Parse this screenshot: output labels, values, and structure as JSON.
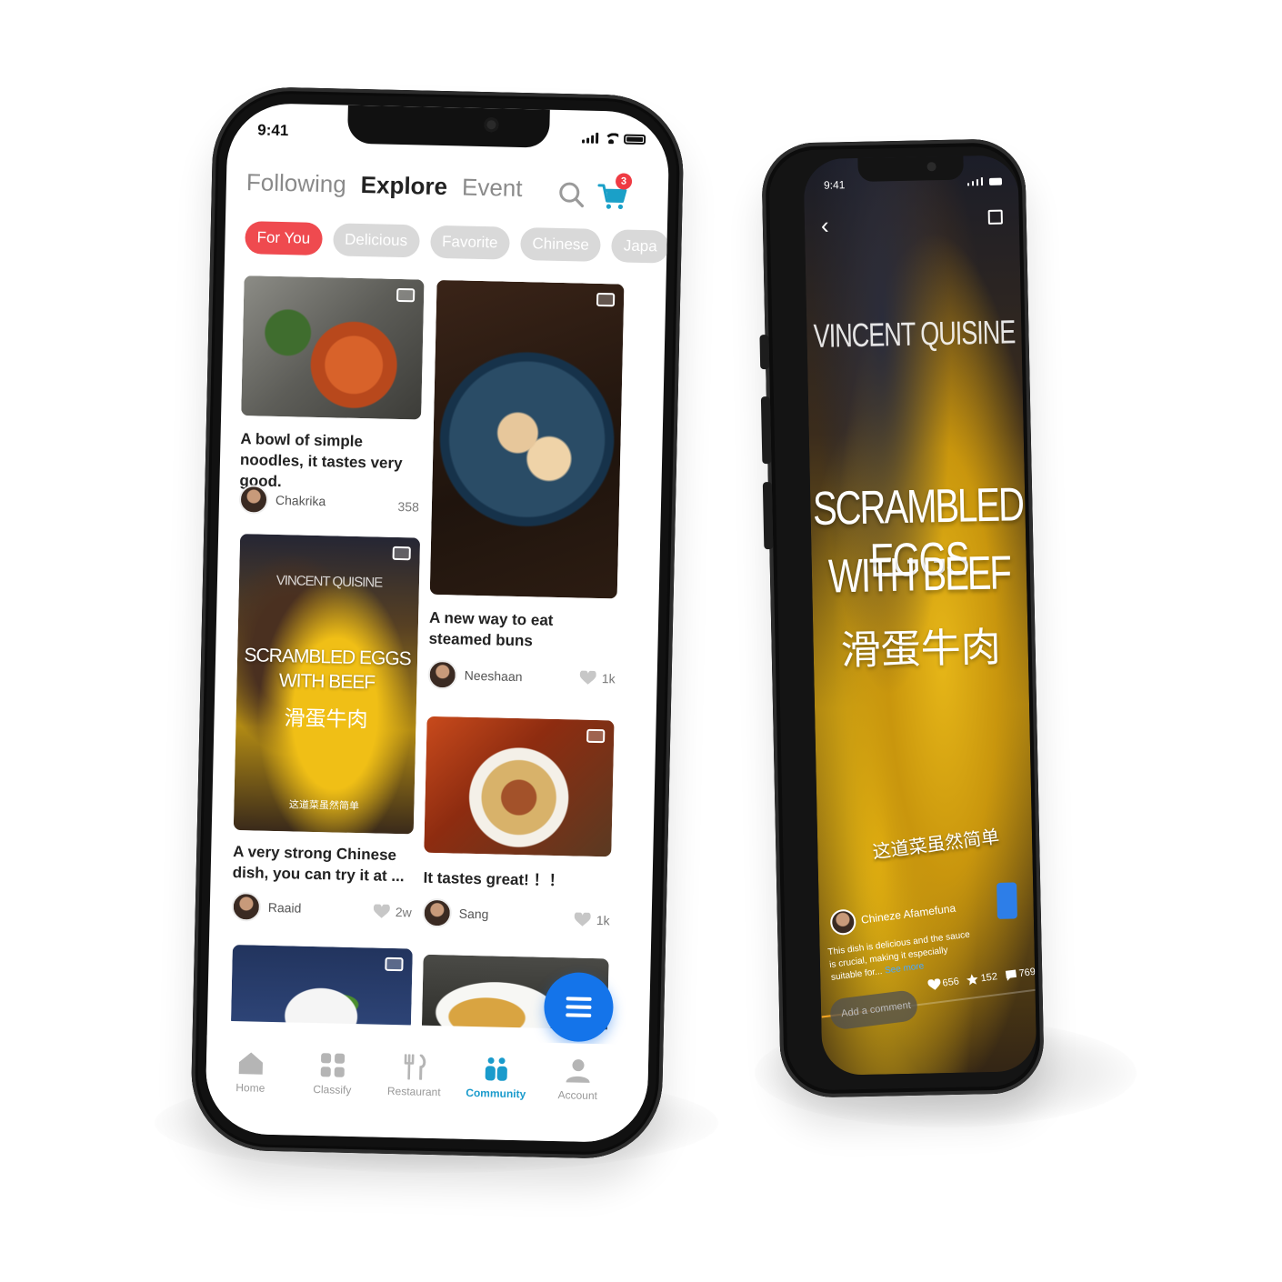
{
  "left_phone": {
    "status": {
      "time": "9:41"
    },
    "tabs": [
      {
        "label": "Following",
        "active": false
      },
      {
        "label": "Explore",
        "active": true
      },
      {
        "label": "Event",
        "active": false
      }
    ],
    "cart_badge": "3",
    "chips": [
      {
        "label": "For You",
        "active": true
      },
      {
        "label": "Delicious",
        "active": false
      },
      {
        "label": "Favorite",
        "active": false
      },
      {
        "label": "Chinese",
        "active": false
      },
      {
        "label": "Japa",
        "active": false
      }
    ],
    "posts": [
      {
        "title": "A bowl of simple noodles, it tastes very good.",
        "author": "Chakrika",
        "count": "358",
        "media": "gallery-icon"
      },
      {
        "title": "A new way to eat steamed buns",
        "author": "Neeshaan",
        "count": "1k",
        "media": "gallery-icon"
      },
      {
        "title": "A very strong Chinese dish, you can try it at ...",
        "author": "Raaid",
        "count": "2w",
        "media": "video-icon",
        "overlay_brand": "VINCENT QUISINE",
        "overlay_title": "SCRAMBLED EGGS WITH BEEF",
        "overlay_cn": "滑蛋牛肉",
        "overlay_sub": "这道菜虽然简单"
      },
      {
        "title": "It tastes great! ！！",
        "author": "Sang",
        "count": "1k",
        "media": "video-icon"
      }
    ],
    "bottom_nav": [
      {
        "label": "Home",
        "icon": "home-icon",
        "active": false
      },
      {
        "label": "Classify",
        "icon": "grid-icon",
        "active": false
      },
      {
        "label": "Restaurant",
        "icon": "fork-knife-icon",
        "active": false
      },
      {
        "label": "Community",
        "icon": "community-icon",
        "active": true
      },
      {
        "label": "Account",
        "icon": "user-icon",
        "active": false
      }
    ],
    "colors": {
      "accent": "#ef4a4f",
      "fab": "#1474ea",
      "nav_active": "#1a9bcc",
      "chip": "#d9d9d9"
    }
  },
  "right_phone": {
    "status": {
      "time": "9:41"
    },
    "video": {
      "brand": "VINCENT QUISINE",
      "title_line1": "SCRAMBLED EGGS",
      "title_line2": "WITH BEEF",
      "title_cn": "滑蛋牛肉",
      "subtitle_cn": "这道菜虽然简单"
    },
    "author": "Chineze Afamefuna",
    "description": "This dish is delicious and the sauce is crucial, making it especially suitable for...",
    "see_more": "See more",
    "comment_placeholder": "Add a comment",
    "stats": {
      "likes": "656",
      "stars": "152",
      "comments": "769"
    },
    "progress": 0.25
  }
}
